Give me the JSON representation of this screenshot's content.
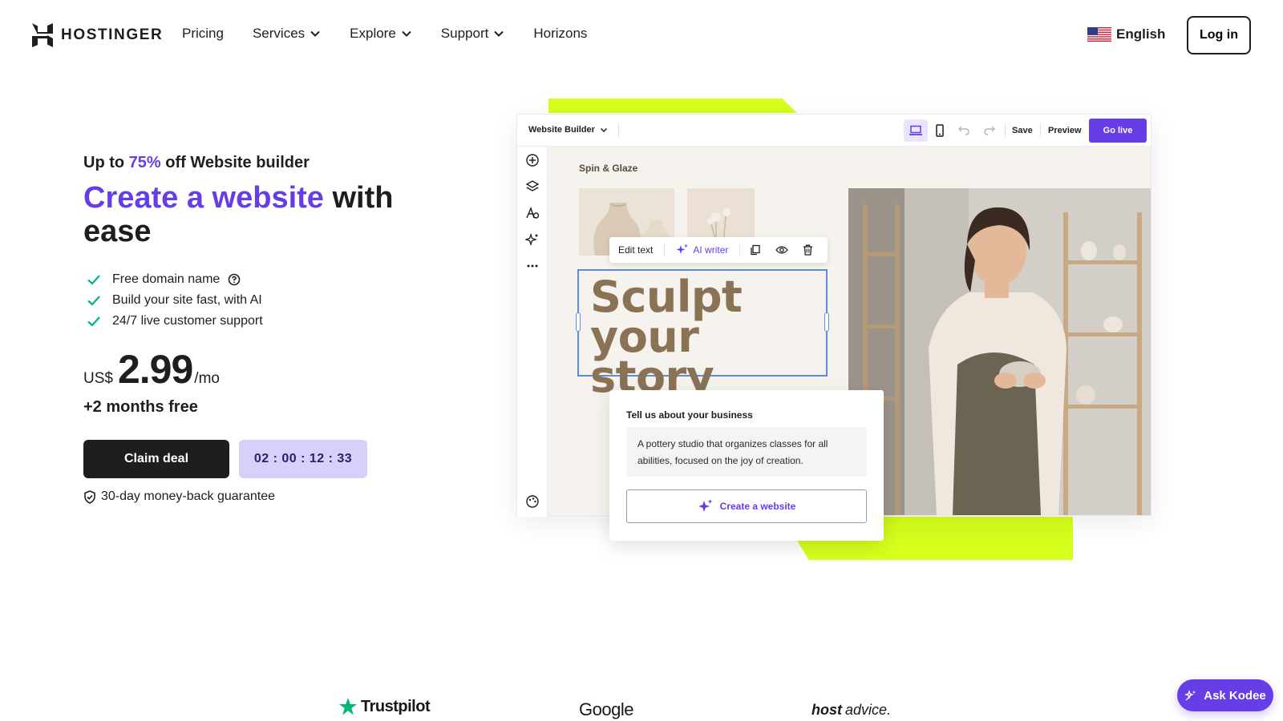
{
  "header": {
    "logo_text": "HOSTINGER",
    "nav": [
      {
        "label": "Pricing",
        "has_dropdown": false
      },
      {
        "label": "Services",
        "has_dropdown": true
      },
      {
        "label": "Explore",
        "has_dropdown": true
      },
      {
        "label": "Support",
        "has_dropdown": true
      },
      {
        "label": "Horizons",
        "has_dropdown": false
      }
    ],
    "language": "English",
    "login_label": "Log in"
  },
  "hero": {
    "promo_prefix": "Up to ",
    "promo_percent": "75%",
    "promo_suffix": " off Website builder",
    "headline_accent": "Create a website",
    "headline_rest": " with ease",
    "features": [
      "Free domain name",
      "Build your site fast, with AI",
      "24/7 live customer support"
    ],
    "price_currency": "US$",
    "price_amount": "2.99",
    "price_period": "/mo",
    "bonus": "+2 months free",
    "claim_label": "Claim deal",
    "timer": "02 : 00 : 12 : 33",
    "guarantee": "30-day money-back guarantee"
  },
  "builder": {
    "title": "Website Builder",
    "save_label": "Save",
    "preview_label": "Preview",
    "golive_label": "Go live",
    "brand_name": "Spin & Glaze",
    "edit_text_label": "Edit text",
    "ai_writer_label": "AI writer",
    "headline_line1": "Sculpt",
    "headline_line2": "your story",
    "biz_title": "Tell us about your business",
    "biz_text": "A pottery studio that organizes classes for all abilities, focused on the joy of creation.",
    "create_label": "Create a website"
  },
  "reviews": {
    "trustpilot": "Trustpilot",
    "google": "Google",
    "hostadvice_bold": "host",
    "hostadvice_rest": "advice."
  },
  "kodee_label": "Ask Kodee",
  "colors": {
    "accent": "#673de6",
    "lime": "#d5ff1c",
    "dark": "#1d1e20",
    "timer_bg": "#d7d0fb",
    "check": "#00b090"
  }
}
